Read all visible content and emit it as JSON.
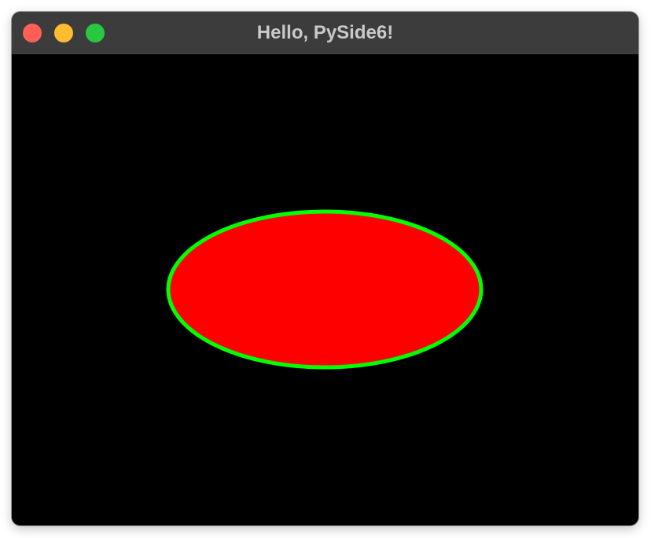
{
  "window": {
    "title": "Hello, PySide6!",
    "buttons": [
      {
        "name": "close",
        "color": "#ff5f57"
      },
      {
        "name": "minimize",
        "color": "#febc2e"
      },
      {
        "name": "zoom",
        "color": "#28c840"
      }
    ]
  },
  "canvas": {
    "background": "#000000",
    "shape": {
      "type": "ellipse",
      "fill": "#ff0000",
      "stroke": "#00ff00"
    }
  }
}
